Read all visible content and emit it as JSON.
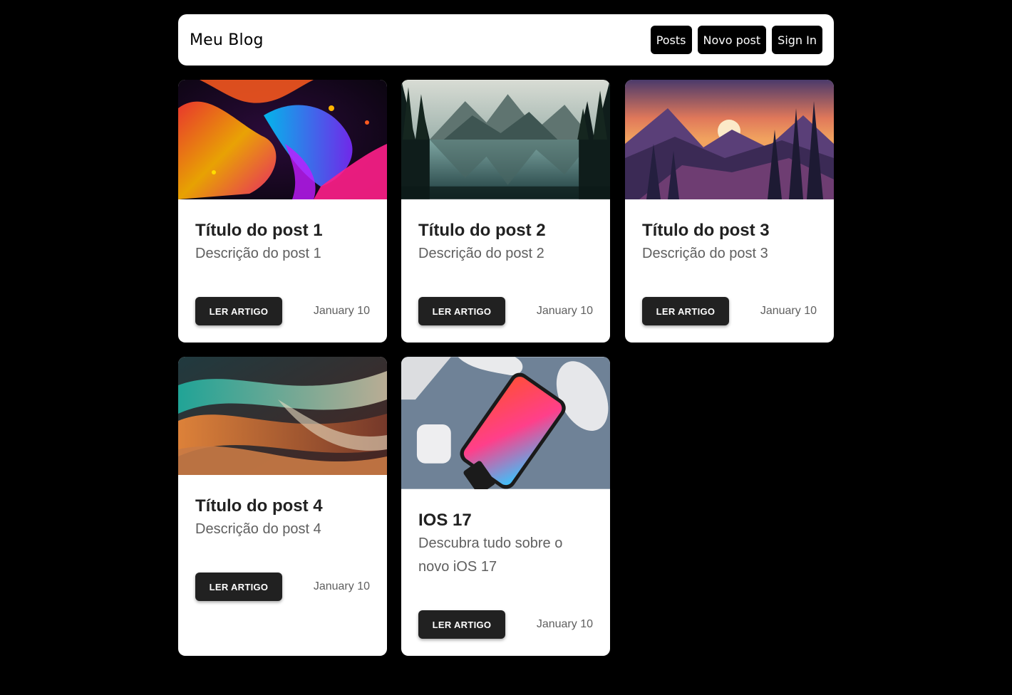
{
  "navbar": {
    "brand": "Meu Blog",
    "buttons": [
      "Posts",
      "Novo post",
      "Sign In"
    ]
  },
  "posts": [
    {
      "title": "Título do post 1",
      "description": "Descrição do post 1",
      "button": "LER ARTIGO",
      "date": "January 10",
      "image": "abstract-fluid-paint-image"
    },
    {
      "title": "Título do post 2",
      "description": "Descrição do post 2",
      "button": "LER ARTIGO",
      "date": "January 10",
      "image": "mountain-lake-reflection-image"
    },
    {
      "title": "Título do post 3",
      "description": "Descrição do post 3",
      "button": "LER ARTIGO",
      "date": "January 10",
      "image": "sunset-forest-illustration-image"
    },
    {
      "title": "Título do post 4",
      "description": "Descrição do post 4",
      "button": "LER ARTIGO",
      "date": "January 10",
      "image": "abstract-silk-waves-image"
    },
    {
      "title": "IOS 17",
      "description": "Descubra tudo sobre o novo iOS 17",
      "button": "LER ARTIGO",
      "date": "January 10",
      "image": "iphone-desk-flatlay-image"
    }
  ]
}
